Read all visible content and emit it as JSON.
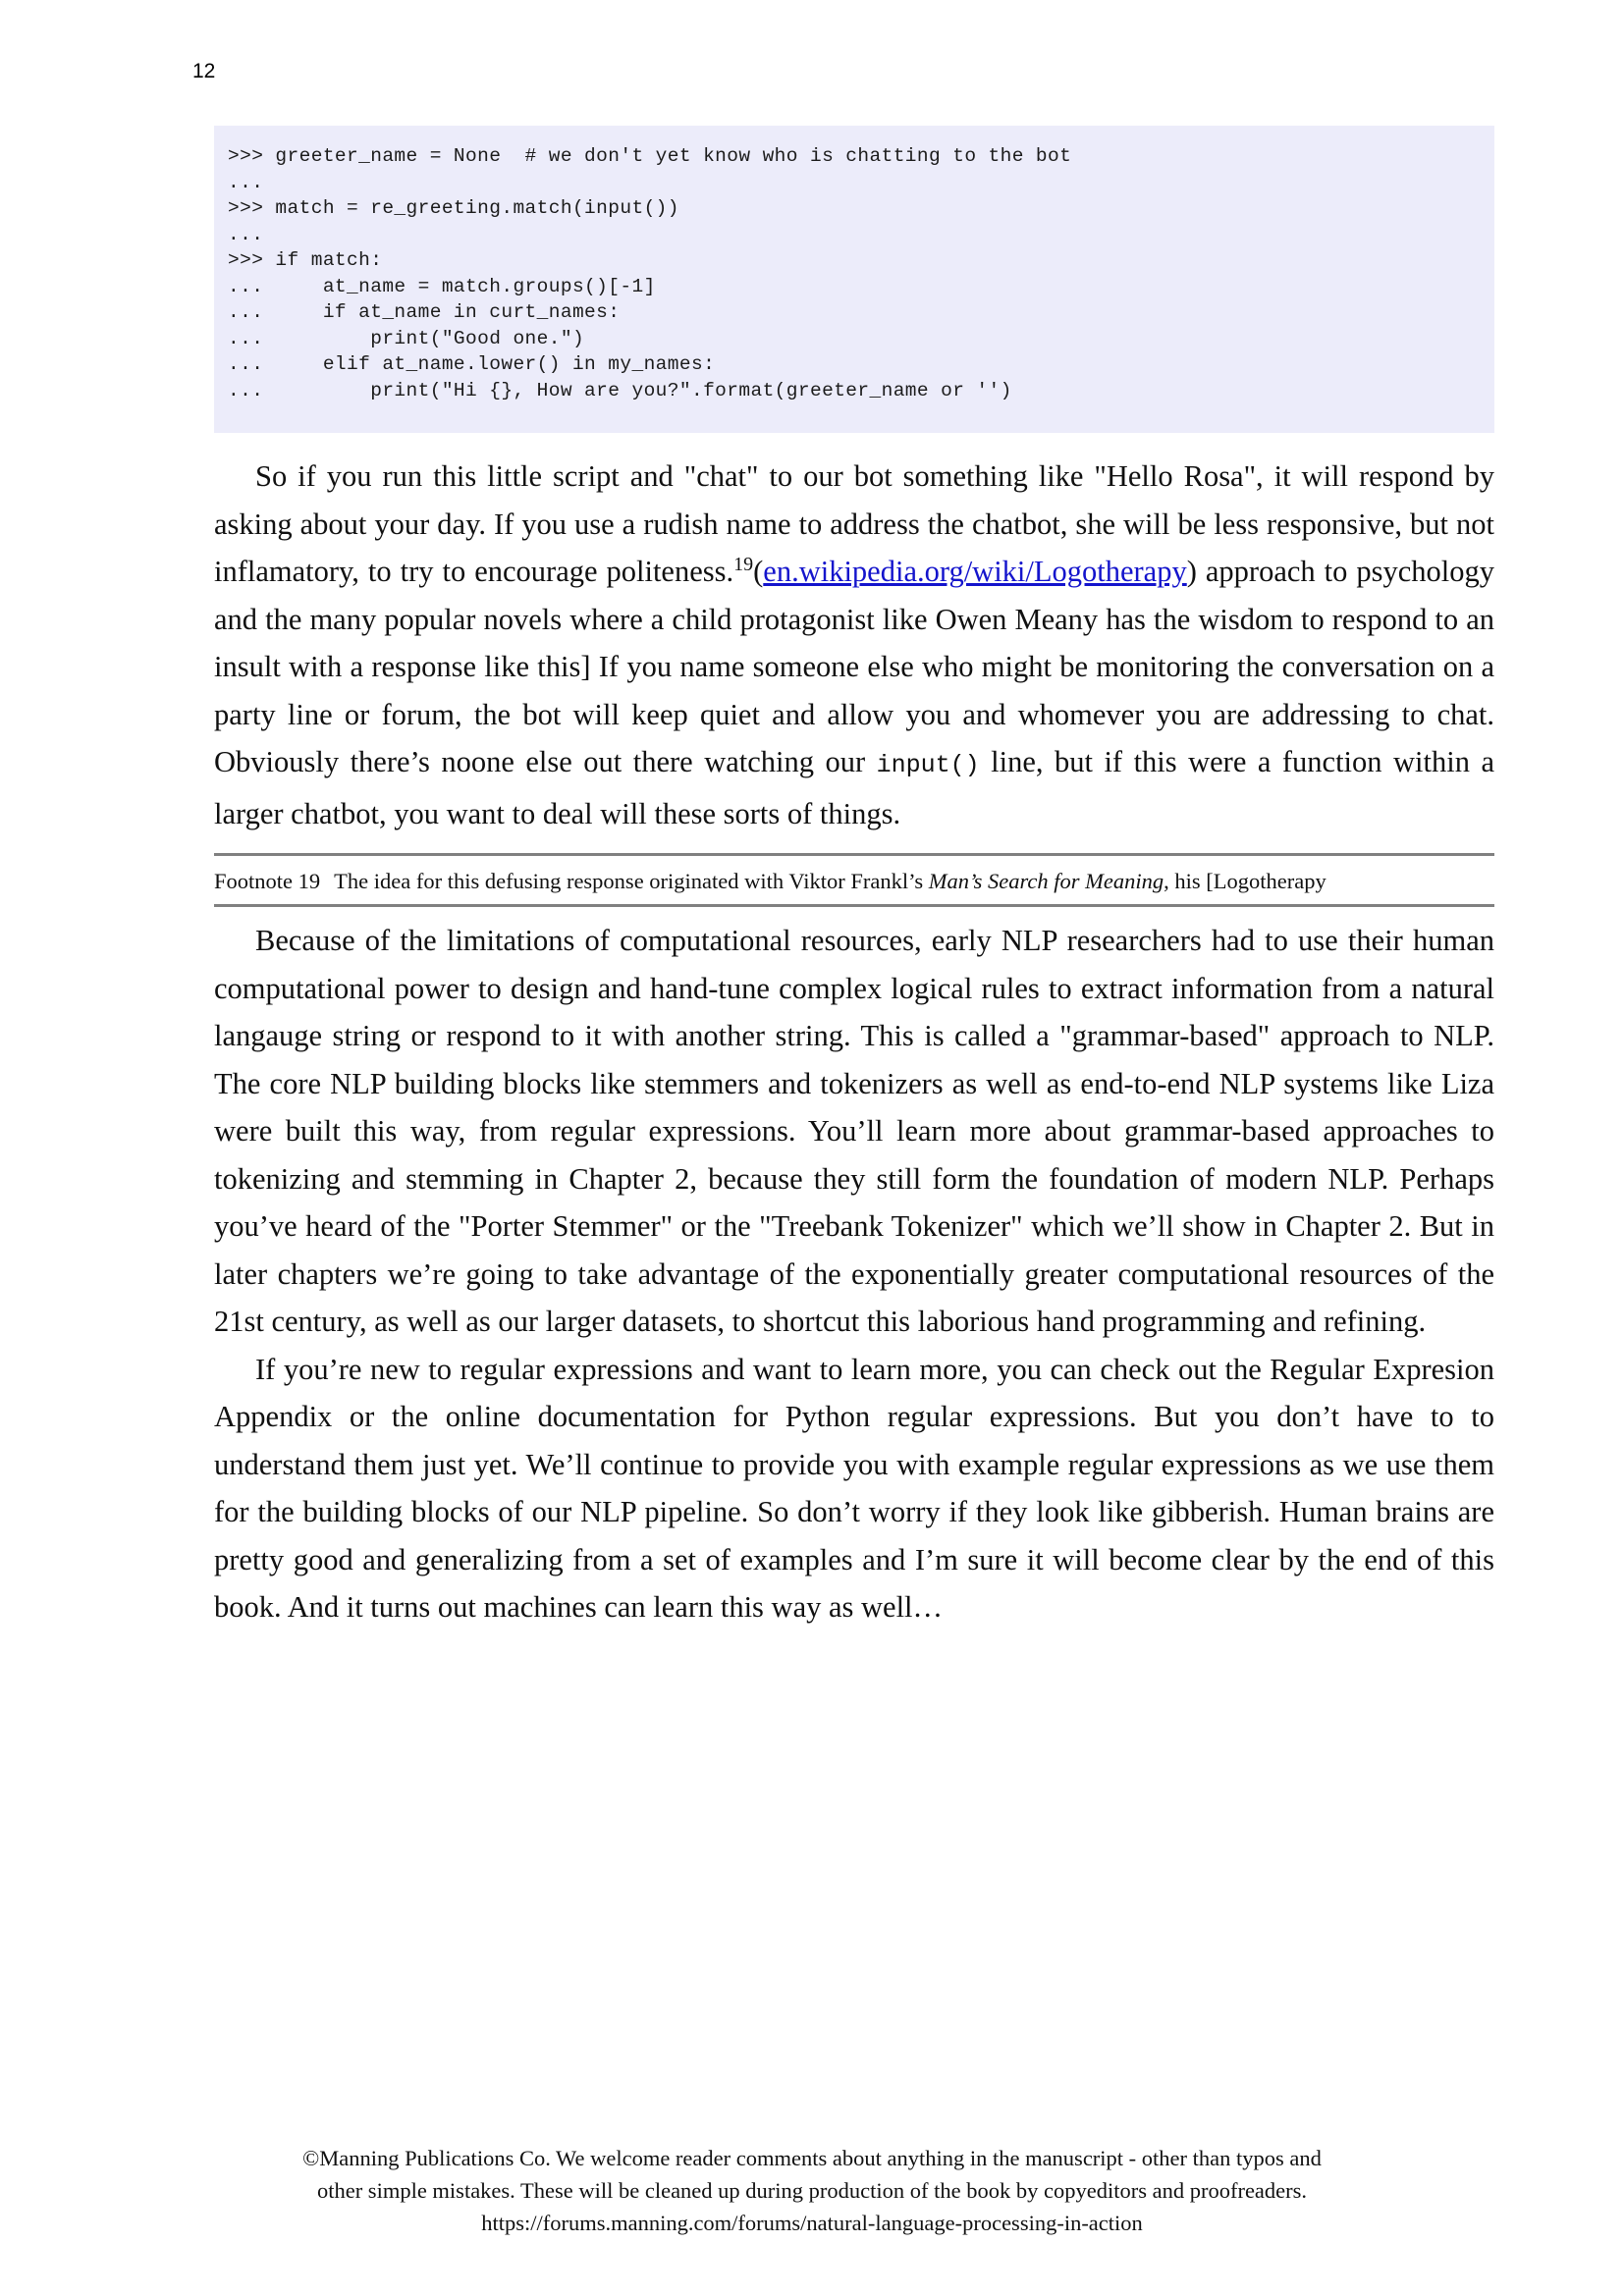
{
  "page": {
    "number": "12"
  },
  "code_block": {
    "language": "python-repl",
    "background_color": "#ececfa",
    "lines": [
      ">>> greeter_name = None  # we don't yet know who is chatting to the bot",
      "...",
      ">>> match = re_greeting.match(input())",
      "...",
      ">>> if match:",
      "...     at_name = match.groups()[-1]",
      "...     if at_name in curt_names:",
      "...         print(\"Good one.\")",
      "...     elif at_name.lower() in my_names:",
      "...         print(\"Hi {}, How are you?\".format(greeter_name or '')"
    ]
  },
  "paragraphs": {
    "p1": {
      "segment_1": "So if you run this little script and \"chat\" to our bot something like \"Hello Rosa\", it will respond by asking about your day. If you use a rudish name to address the chatbot, she will be less responsive, but not inflamatory, to try to encourage politeness.",
      "footnote_marker": "19",
      "segment_2": "(",
      "link_text": "en.wikipedia.org/wiki/Logotherapy",
      "link_color": "#1414cc",
      "segment_3": ") approach to psychology and the many popular novels where a child protagonist like Owen Meany has the wisdom to respond to an insult with a response like this] If you name someone else who might be monitoring the conversation on a party line or forum, the bot will keep quiet and allow you and whomever you are addressing to chat. Obviously there’s noone else out there watching our ",
      "code_inline": "input()",
      "segment_4": " line, but if this were a function within a larger chatbot, you want to deal will these sorts of things."
    },
    "p2": "Because of the limitations of computational resources, early NLP researchers had to use their human computational power to design and hand-tune complex logical rules to extract information from a natural langauge string or respond to it with another string. This is called a \"grammar-based\" approach to NLP. The core NLP building blocks like stemmers and tokenizers as well as end-to-end NLP systems like Liza were built this way, from regular expressions. You’ll learn more about grammar-based approaches to tokenizing and stemming in Chapter 2, because they still form the foundation of modern NLP. Perhaps you’ve heard of the \"Porter Stemmer\" or the \"Treebank Tokenizer\" which we’ll show in Chapter 2. But in later chapters we’re going to take advantage of the exponentially greater computational resources of the 21st century, as well as our larger datasets, to shortcut this laborious hand programming and refining.",
    "p3": "If you’re new to regular expressions and want to learn more, you can check out the Regular Expresion Appendix or the online documentation for Python regular expressions. But you don’t have to to understand them just yet. We’ll continue to provide you with example regular expressions as we use them for the building blocks of our NLP pipeline. So don’t worry if they look like gibberish. Human brains are pretty good and generalizing from a set of examples and I’m sure it will become clear by the end of this book. And it turns out machines can learn this way as well…"
  },
  "footnote": {
    "label": "Footnote 19",
    "text_before_italic": "The idea for this defusing response originated with Viktor Frankl’s ",
    "italic_title": "Man’s Search for Meaning",
    "text_after_italic": ", his [Logotherapy",
    "rule_color": "#808080"
  },
  "footer": {
    "line1": "©Manning Publications Co. We welcome reader comments about anything in the manuscript - other than typos and",
    "line2": "other simple mistakes. These will be cleaned up during production of the book by copyeditors and proofreaders.",
    "line3": "https://forums.manning.com/forums/natural-language-processing-in-action"
  }
}
